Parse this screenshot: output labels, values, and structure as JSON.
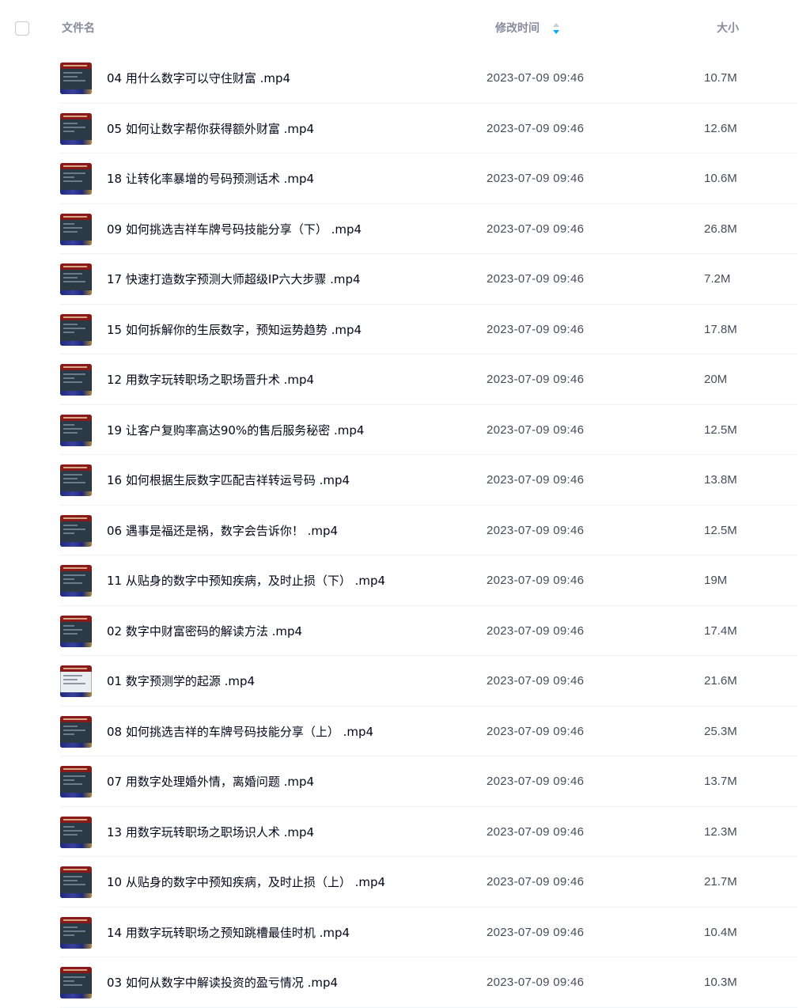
{
  "header": {
    "name_label": "文件名",
    "time_label": "修改时间",
    "size_label": "大小",
    "sort_icon": "sort-arrows-icon"
  },
  "files": [
    {
      "name": "04 用什么数字可以守住财富 .mp4",
      "time": "2023-07-09 09:46",
      "size": "10.7M",
      "thumb": "video-thumbnail"
    },
    {
      "name": "05 如何让数字帮你获得额外财富 .mp4",
      "time": "2023-07-09 09:46",
      "size": "12.6M",
      "thumb": "video-thumbnail"
    },
    {
      "name": "18 让转化率暴增的号码预测话术 .mp4",
      "time": "2023-07-09 09:46",
      "size": "10.6M",
      "thumb": "video-thumbnail"
    },
    {
      "name": "09 如何挑选吉祥车牌号码技能分享（下） .mp4",
      "time": "2023-07-09 09:46",
      "size": "26.8M",
      "thumb": "video-thumbnail"
    },
    {
      "name": "17 快速打造数字预测大师超级IP六大步骤 .mp4",
      "time": "2023-07-09 09:46",
      "size": "7.2M",
      "thumb": "video-thumbnail"
    },
    {
      "name": "15 如何拆解你的生辰数字，预知运势趋势 .mp4",
      "time": "2023-07-09 09:46",
      "size": "17.8M",
      "thumb": "video-thumbnail"
    },
    {
      "name": "12 用数字玩转职场之职场晋升术 .mp4",
      "time": "2023-07-09 09:46",
      "size": "20M",
      "thumb": "video-thumbnail"
    },
    {
      "name": "19 让客户复购率高达90%的售后服务秘密 .mp4",
      "time": "2023-07-09 09:46",
      "size": "12.5M",
      "thumb": "video-thumbnail"
    },
    {
      "name": "16 如何根据生辰数字匹配吉祥转运号码 .mp4",
      "time": "2023-07-09 09:46",
      "size": "13.8M",
      "thumb": "video-thumbnail"
    },
    {
      "name": "06 遇事是福还是祸，数字会告诉你！ .mp4",
      "time": "2023-07-09 09:46",
      "size": "12.5M",
      "thumb": "video-thumbnail"
    },
    {
      "name": "11 从贴身的数字中预知疾病，及时止损（下） .mp4",
      "time": "2023-07-09 09:46",
      "size": "19M",
      "thumb": "video-thumbnail"
    },
    {
      "name": "02 数字中财富密码的解读方法 .mp4",
      "time": "2023-07-09 09:46",
      "size": "17.4M",
      "thumb": "video-thumbnail"
    },
    {
      "name": "01 数字预测学的起源 .mp4",
      "time": "2023-07-09 09:46",
      "size": "21.6M",
      "thumb": "video-thumbnail"
    },
    {
      "name": "08 如何挑选吉祥的车牌号码技能分享（上） .mp4",
      "time": "2023-07-09 09:46",
      "size": "25.3M",
      "thumb": "video-thumbnail"
    },
    {
      "name": "07 用数字处理婚外情，离婚问题 .mp4",
      "time": "2023-07-09 09:46",
      "size": "13.7M",
      "thumb": "video-thumbnail"
    },
    {
      "name": "13 用数字玩转职场之职场识人术 .mp4",
      "time": "2023-07-09 09:46",
      "size": "12.3M",
      "thumb": "video-thumbnail"
    },
    {
      "name": "10 从贴身的数字中预知疾病，及时止损（上） .mp4",
      "time": "2023-07-09 09:46",
      "size": "21.7M",
      "thumb": "video-thumbnail"
    },
    {
      "name": "14 用数字玩转职场之预知跳槽最佳时机 .mp4",
      "time": "2023-07-09 09:46",
      "size": "10.4M",
      "thumb": "video-thumbnail"
    },
    {
      "name": "03 如何从数字中解读投资的盈亏情况 .mp4",
      "time": "2023-07-09 09:46",
      "size": "10.3M",
      "thumb": "video-thumbnail"
    }
  ],
  "colors": {
    "header_text": "#878c9c",
    "row_text": "#03081a",
    "meta_text": "#454d5a",
    "divider": "#f0f1f4",
    "sort_accent": "#06a7ff"
  }
}
